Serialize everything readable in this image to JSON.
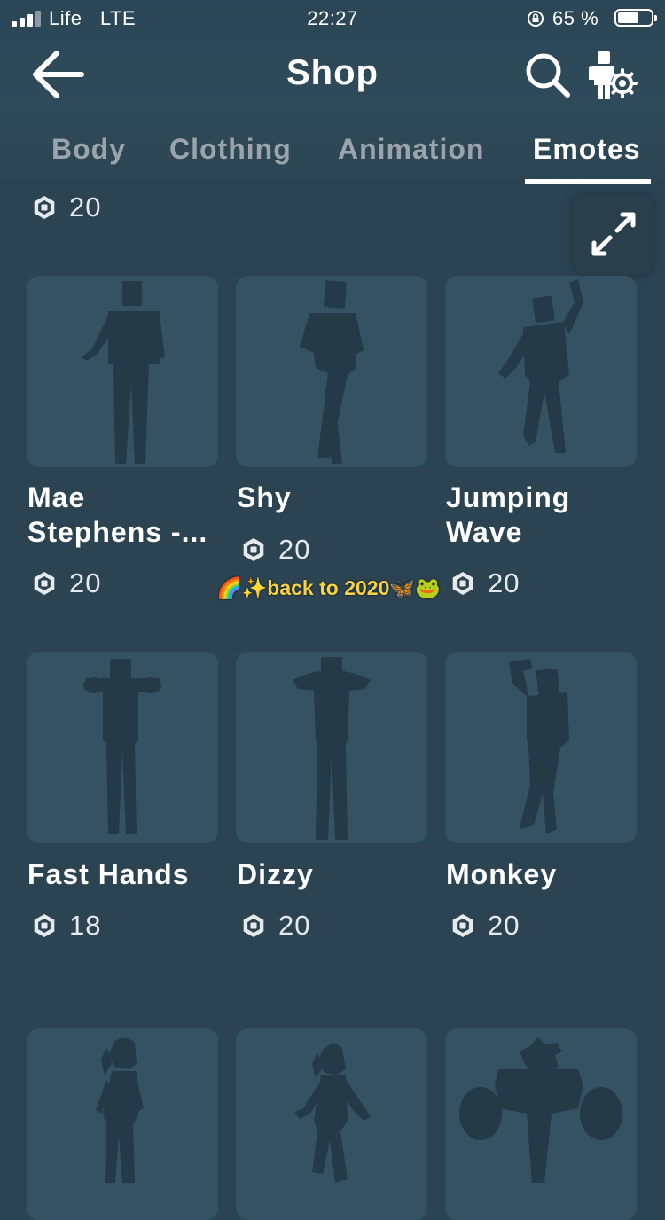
{
  "status_bar": {
    "carrier": "Life",
    "network": "LTE",
    "time": "22:27",
    "battery": "65 %",
    "battery_level": 0.65
  },
  "nav": {
    "title": "Shop",
    "back_icon": "back-arrow-icon",
    "search_icon": "search-icon",
    "avatar_settings_icon": "avatar-settings-icon"
  },
  "tabs": [
    "Body",
    "Clothing",
    "Animation",
    "Emotes"
  ],
  "active_tab": "Emotes",
  "partial_item": {
    "price": "20"
  },
  "expand_icon": "expand-icon",
  "currency_icon": "robux-icon",
  "items": [
    {
      "name": "Mae Stephens -...",
      "price": "20"
    },
    {
      "name": "Shy",
      "price": "20"
    },
    {
      "name": "Jumping Wave",
      "price": "20"
    },
    {
      "name": "Fast Hands",
      "price": "18"
    },
    {
      "name": "Dizzy",
      "price": "20"
    },
    {
      "name": "Monkey",
      "price": "20"
    }
  ],
  "overlay_text": "🌈✨back to 2020🦋🐸",
  "colors": {
    "background": "#2c4452",
    "card": "#345261",
    "silhouette": "#243a47",
    "overlay_text": "#f5d342"
  }
}
